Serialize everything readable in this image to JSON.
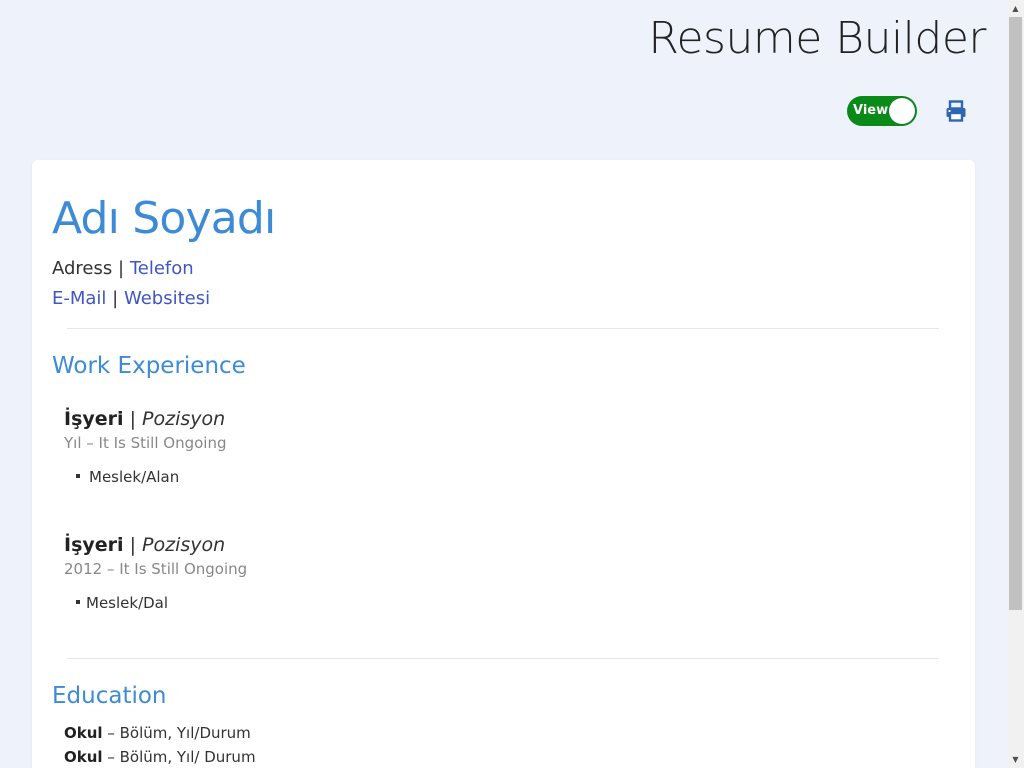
{
  "header": {
    "title": "Resume Builder",
    "view_toggle": {
      "label": "View",
      "on": true,
      "color": "#0a8a18"
    },
    "print_icon": "printer-icon"
  },
  "resume": {
    "name": "Adı Soyadı",
    "contact": {
      "address": "Adress",
      "phone": "Telefon",
      "email": "E-Mail",
      "website": "Websitesi",
      "separator": "|"
    },
    "work_experience": {
      "heading": "Work Experience",
      "jobs": [
        {
          "employer": "İşyeri",
          "separator": "|",
          "position": "Pozisyon",
          "period": "Yıl – It Is Still Ongoing",
          "bullets": [
            "Meslek/Alan"
          ]
        },
        {
          "employer": "İşyeri",
          "separator": "|",
          "position": "Pozisyon",
          "period": "2012 – It Is Still Ongoing",
          "bullets": [
            "Meslek/Dal"
          ]
        }
      ]
    },
    "education": {
      "heading": "Education",
      "items": [
        {
          "school": "Okul",
          "details": " – Bölüm, Yıl/Durum"
        },
        {
          "school": "Okul",
          "details": " – Bölüm, Yıl/ Durum"
        }
      ]
    }
  },
  "colors": {
    "accent": "#3d8bd6",
    "link": "#3f56c4",
    "background": "#eef3fb"
  }
}
